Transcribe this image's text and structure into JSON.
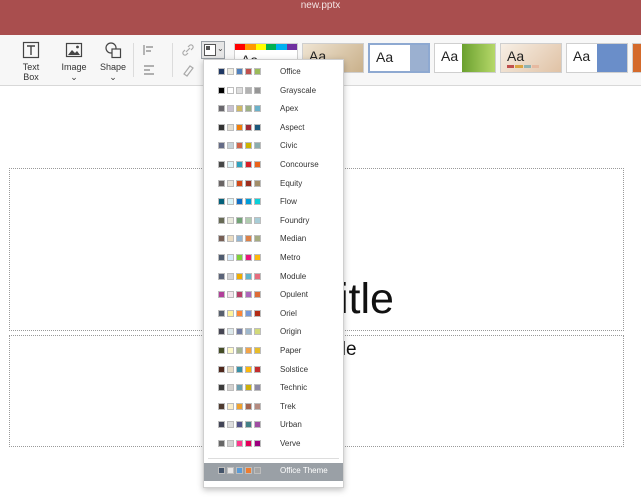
{
  "window": {
    "title": "new.pptx"
  },
  "colors": {
    "titlebar": "#a94e4e",
    "toolbar": "#f7f7f7",
    "menu_selected": "#9aa0a6"
  },
  "toolbar": {
    "text_box": "Text Box",
    "image": "Image",
    "shape": "Shape",
    "icons": [
      "text-box-icon",
      "image-icon",
      "shape-icon",
      "align-icon",
      "arrange-icon",
      "link-icon",
      "eraser-icon",
      "color-scheme-icon"
    ]
  },
  "theme_gallery": [
    {
      "label": "Aa"
    },
    {
      "label": "Aa"
    },
    {
      "label": "Aa"
    },
    {
      "label": "Aa"
    },
    {
      "label": "Aa"
    },
    {
      "label": "Aa"
    },
    {
      "label": "Aa"
    }
  ],
  "slide": {
    "title_partial": "title",
    "subtitle_partial": "title"
  },
  "color_schemes": [
    {
      "name": "Office",
      "swatches": [
        "#1f3864",
        "#eeece1",
        "#4f81bd",
        "#c0504d",
        "#9bbb59"
      ]
    },
    {
      "name": "Grayscale",
      "swatches": [
        "#000000",
        "#ffffff",
        "#dddddd",
        "#b2b2b2",
        "#969696"
      ]
    },
    {
      "name": "Apex",
      "swatches": [
        "#69676d",
        "#c9c2d1",
        "#ceb966",
        "#9cb084",
        "#6bb1c9"
      ]
    },
    {
      "name": "Aspect",
      "swatches": [
        "#323232",
        "#e3ded1",
        "#f07f09",
        "#9f2936",
        "#1b587c"
      ]
    },
    {
      "name": "Civic",
      "swatches": [
        "#646b86",
        "#c5d1d7",
        "#d16349",
        "#ccb400",
        "#8cadae"
      ]
    },
    {
      "name": "Concourse",
      "swatches": [
        "#464646",
        "#def5fa",
        "#2da2bf",
        "#da1f28",
        "#eb641b"
      ]
    },
    {
      "name": "Equity",
      "swatches": [
        "#696464",
        "#e9e5dc",
        "#d34817",
        "#9b2d1f",
        "#a28e6a"
      ]
    },
    {
      "name": "Flow",
      "swatches": [
        "#04617b",
        "#dbf5f9",
        "#0f6fc6",
        "#009dd9",
        "#0bd0d9"
      ]
    },
    {
      "name": "Foundry",
      "swatches": [
        "#676a55",
        "#eaebde",
        "#72a376",
        "#b0ccb0",
        "#a8cdd7"
      ]
    },
    {
      "name": "Median",
      "swatches": [
        "#775f55",
        "#ebddc3",
        "#94b6d2",
        "#dd8047",
        "#a5ab81"
      ]
    },
    {
      "name": "Metro",
      "swatches": [
        "#4e5b6f",
        "#d6ecff",
        "#7fd13b",
        "#ea157a",
        "#feb80a"
      ]
    },
    {
      "name": "Module",
      "swatches": [
        "#5a6378",
        "#d4d4d6",
        "#f0ad00",
        "#60b5cc",
        "#e66c7d"
      ]
    },
    {
      "name": "Opulent",
      "swatches": [
        "#b13f9a",
        "#f4e7ed",
        "#b83d68",
        "#ac66bb",
        "#de6c36"
      ]
    },
    {
      "name": "Oriel",
      "swatches": [
        "#575f6d",
        "#fff39d",
        "#fe8637",
        "#7598d9",
        "#b32c16"
      ]
    },
    {
      "name": "Origin",
      "swatches": [
        "#464653",
        "#dde9ec",
        "#727ca3",
        "#9fb8cd",
        "#d2da7a"
      ]
    },
    {
      "name": "Paper",
      "swatches": [
        "#444d26",
        "#fefac9",
        "#a5b592",
        "#f3a447",
        "#e7bc29"
      ]
    },
    {
      "name": "Solstice",
      "swatches": [
        "#4f271c",
        "#e7dec9",
        "#3891a7",
        "#feb80a",
        "#c32d2e"
      ]
    },
    {
      "name": "Technic",
      "swatches": [
        "#3b3b3b",
        "#d4d2d0",
        "#6ea0b0",
        "#ccaf0a",
        "#8d89a4"
      ]
    },
    {
      "name": "Trek",
      "swatches": [
        "#4e3b30",
        "#fbeec9",
        "#f0a22e",
        "#a5644e",
        "#b58b80"
      ]
    },
    {
      "name": "Urban",
      "swatches": [
        "#424456",
        "#dedede",
        "#53548a",
        "#438086",
        "#a04da3"
      ]
    },
    {
      "name": "Verve",
      "swatches": [
        "#666666",
        "#d2d2d2",
        "#ff388c",
        "#e40059",
        "#9c007f"
      ]
    }
  ],
  "selected_scheme": {
    "name": "Office Theme",
    "swatches": [
      "#44546a",
      "#e7e6e6",
      "#5b9bd5",
      "#ed7d31",
      "#a5a5a5"
    ]
  }
}
